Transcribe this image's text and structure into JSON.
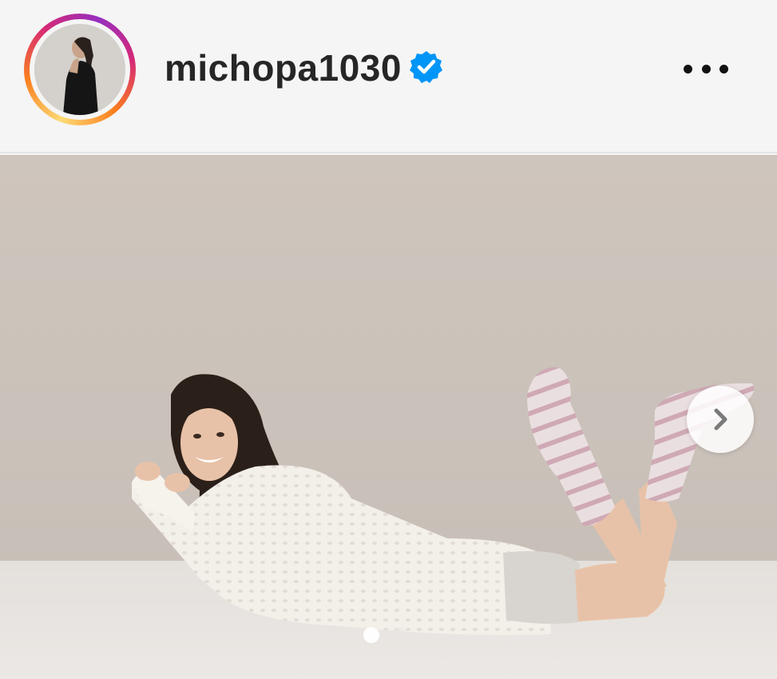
{
  "post": {
    "username": "michopa1030",
    "verified": true,
    "verified_icon": "verified-badge-icon",
    "more_icon": "more-options-icon",
    "next_icon": "chevron-right-icon"
  },
  "carousel": {
    "current_slide": 1,
    "total_slides": 2
  },
  "colors": {
    "verified_blue": "#0095f6",
    "text": "#262626",
    "header_bg": "#f5f5f5"
  }
}
